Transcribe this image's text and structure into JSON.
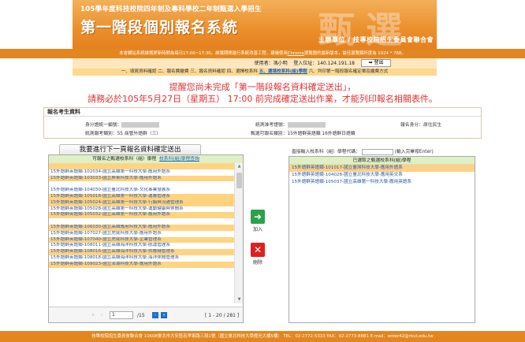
{
  "header": {
    "subtitle": "105學年度科技校院四年制及專科學校二年制甄選入學招生",
    "title": "第一階段個別報名系統",
    "brand": "甄選",
    "organizer": "主辦單位 / 技專校院招生委員會聯合會"
  },
  "notice": {
    "before": "本會網站系統維護更新時間為每日17:00~17:30，維護期間進行系統改善工程，建議使用",
    "link": "Chrome",
    "after": "瀏覽器的最新版本，最佳瀏覽解析度為 1024 * 768。"
  },
  "userbar": {
    "user_label": "使用者：馮小明",
    "ip_label": "登入位址：140.124.191.18",
    "logout": "登出"
  },
  "steps": {
    "items": [
      "一、填寫資料確認",
      "二、報名費繳費",
      "三、報名資料確認",
      "四、選擇校系科"
    ],
    "current": "五、選填校系科(組)學程",
    "rest": "六、列印第一階段報名確定單及繳費方式"
  },
  "alerts": {
    "line1": "提醒您尚未完成「第一階段報名資料確定送出」，",
    "line2": "請務必於105年5月27日（星期五） 17:00 前完成確定送出作業，才能列印報名相關表件。"
  },
  "info": {
    "title": "報名考生資料",
    "id_label": "身分證統一編號：",
    "exam_no_label": "統測准考證號：",
    "status_label": "報名身分：",
    "status_value": "原住民生",
    "group_label": "統測報考類別：",
    "group_value": "55 商管外語群（三）",
    "choose_label": "甄選可報名類別：",
    "choose_value": "15外語群英語類  16外語群日語類"
  },
  "left": {
    "next_button": "我要進行下一頁報名資料確定送出",
    "head_text": "可報名之甄選校系科（組）學程",
    "head_link": "校系科(組)學程查詢",
    "items": [
      {
        "text": "",
        "hl": true
      },
      {
        "text": "15外語群英語類-102034-國立高雄第一科技大學-應用外語系",
        "hl": false
      },
      {
        "text": "15外語群英語類-103033-國立屏東科技大學-應用外語系",
        "hl": true
      },
      {
        "text": "",
        "hl": false
      },
      {
        "text": "15外語群英語類-104030-國立臺北科技大學-文化事業發展系",
        "hl": false
      },
      {
        "text": "15外語群英語類-105018-國立高雄第一科技大學-運籌管理系",
        "hl": true
      },
      {
        "text": "15外語群英語類-105024-國立高雄第一科技大學-行銷與流通管理系",
        "hl": true
      },
      {
        "text": "15外語群英語類-105028-國立高雄第一科技大學-運動健康與休閒系",
        "hl": false
      },
      {
        "text": "15外語群英語類-105032-國立高雄第一科技大學-應用外語系",
        "hl": true
      },
      {
        "text": "",
        "hl": false
      },
      {
        "text": "15外語群英語類-106030-國立高雄應用科技大學-應用外語系",
        "hl": true
      },
      {
        "text": "15外語群英語類-107027-國立虎尾科技大學-應用外語系",
        "hl": false
      },
      {
        "text": "15外語群英語類-107040-國立虎尾科技大學-企業管理系",
        "hl": true
      },
      {
        "text": "15外語群英語類-108011-國立高雄海洋科技大學-航運管理系",
        "hl": false
      },
      {
        "text": "15外語群英語類-108016-國立高雄海洋科技大學-供應鏈管理系",
        "hl": true
      },
      {
        "text": "15外語群英語類-108018-國立高雄海洋科技大學-海洋休閒管理系",
        "hl": false
      },
      {
        "text": "15外語群英語類-109023-國立澎湖科技大學-應用外語系",
        "hl": true
      }
    ],
    "pager": {
      "page": "1",
      "total_pages": "/15",
      "range": "[ 1 - 20 / 281 ]"
    }
  },
  "middle": {
    "add": "加入",
    "remove": "刪除"
  },
  "right": {
    "direct_label": "直接輸入校系科（組）學程代碼：",
    "direct_hint": "(輸入完畢按Enter)",
    "head_text": "已選取之甄選校系科(組)學程",
    "items": [
      {
        "text": "15外語群英語類-101017-國立臺灣科技大學-應用外語系",
        "hl": true
      },
      {
        "text": "15外語群英語類-104028-國立臺北科技大學-應用英文系",
        "hl": false
      },
      {
        "text": "15外語群英語類-105037-國立高雄第一科技大學-應用英語系",
        "hl": false
      }
    ]
  },
  "footer": {
    "text": "技專校院招生委員會聯合會 10608臺北市大安區忠孝東路三段1號（國立臺北科技大學億光大樓5樓） TEL：02-2772-5333 FAX：02-2773-8881 E-mail：enter42@ntut.edu.tw"
  }
}
